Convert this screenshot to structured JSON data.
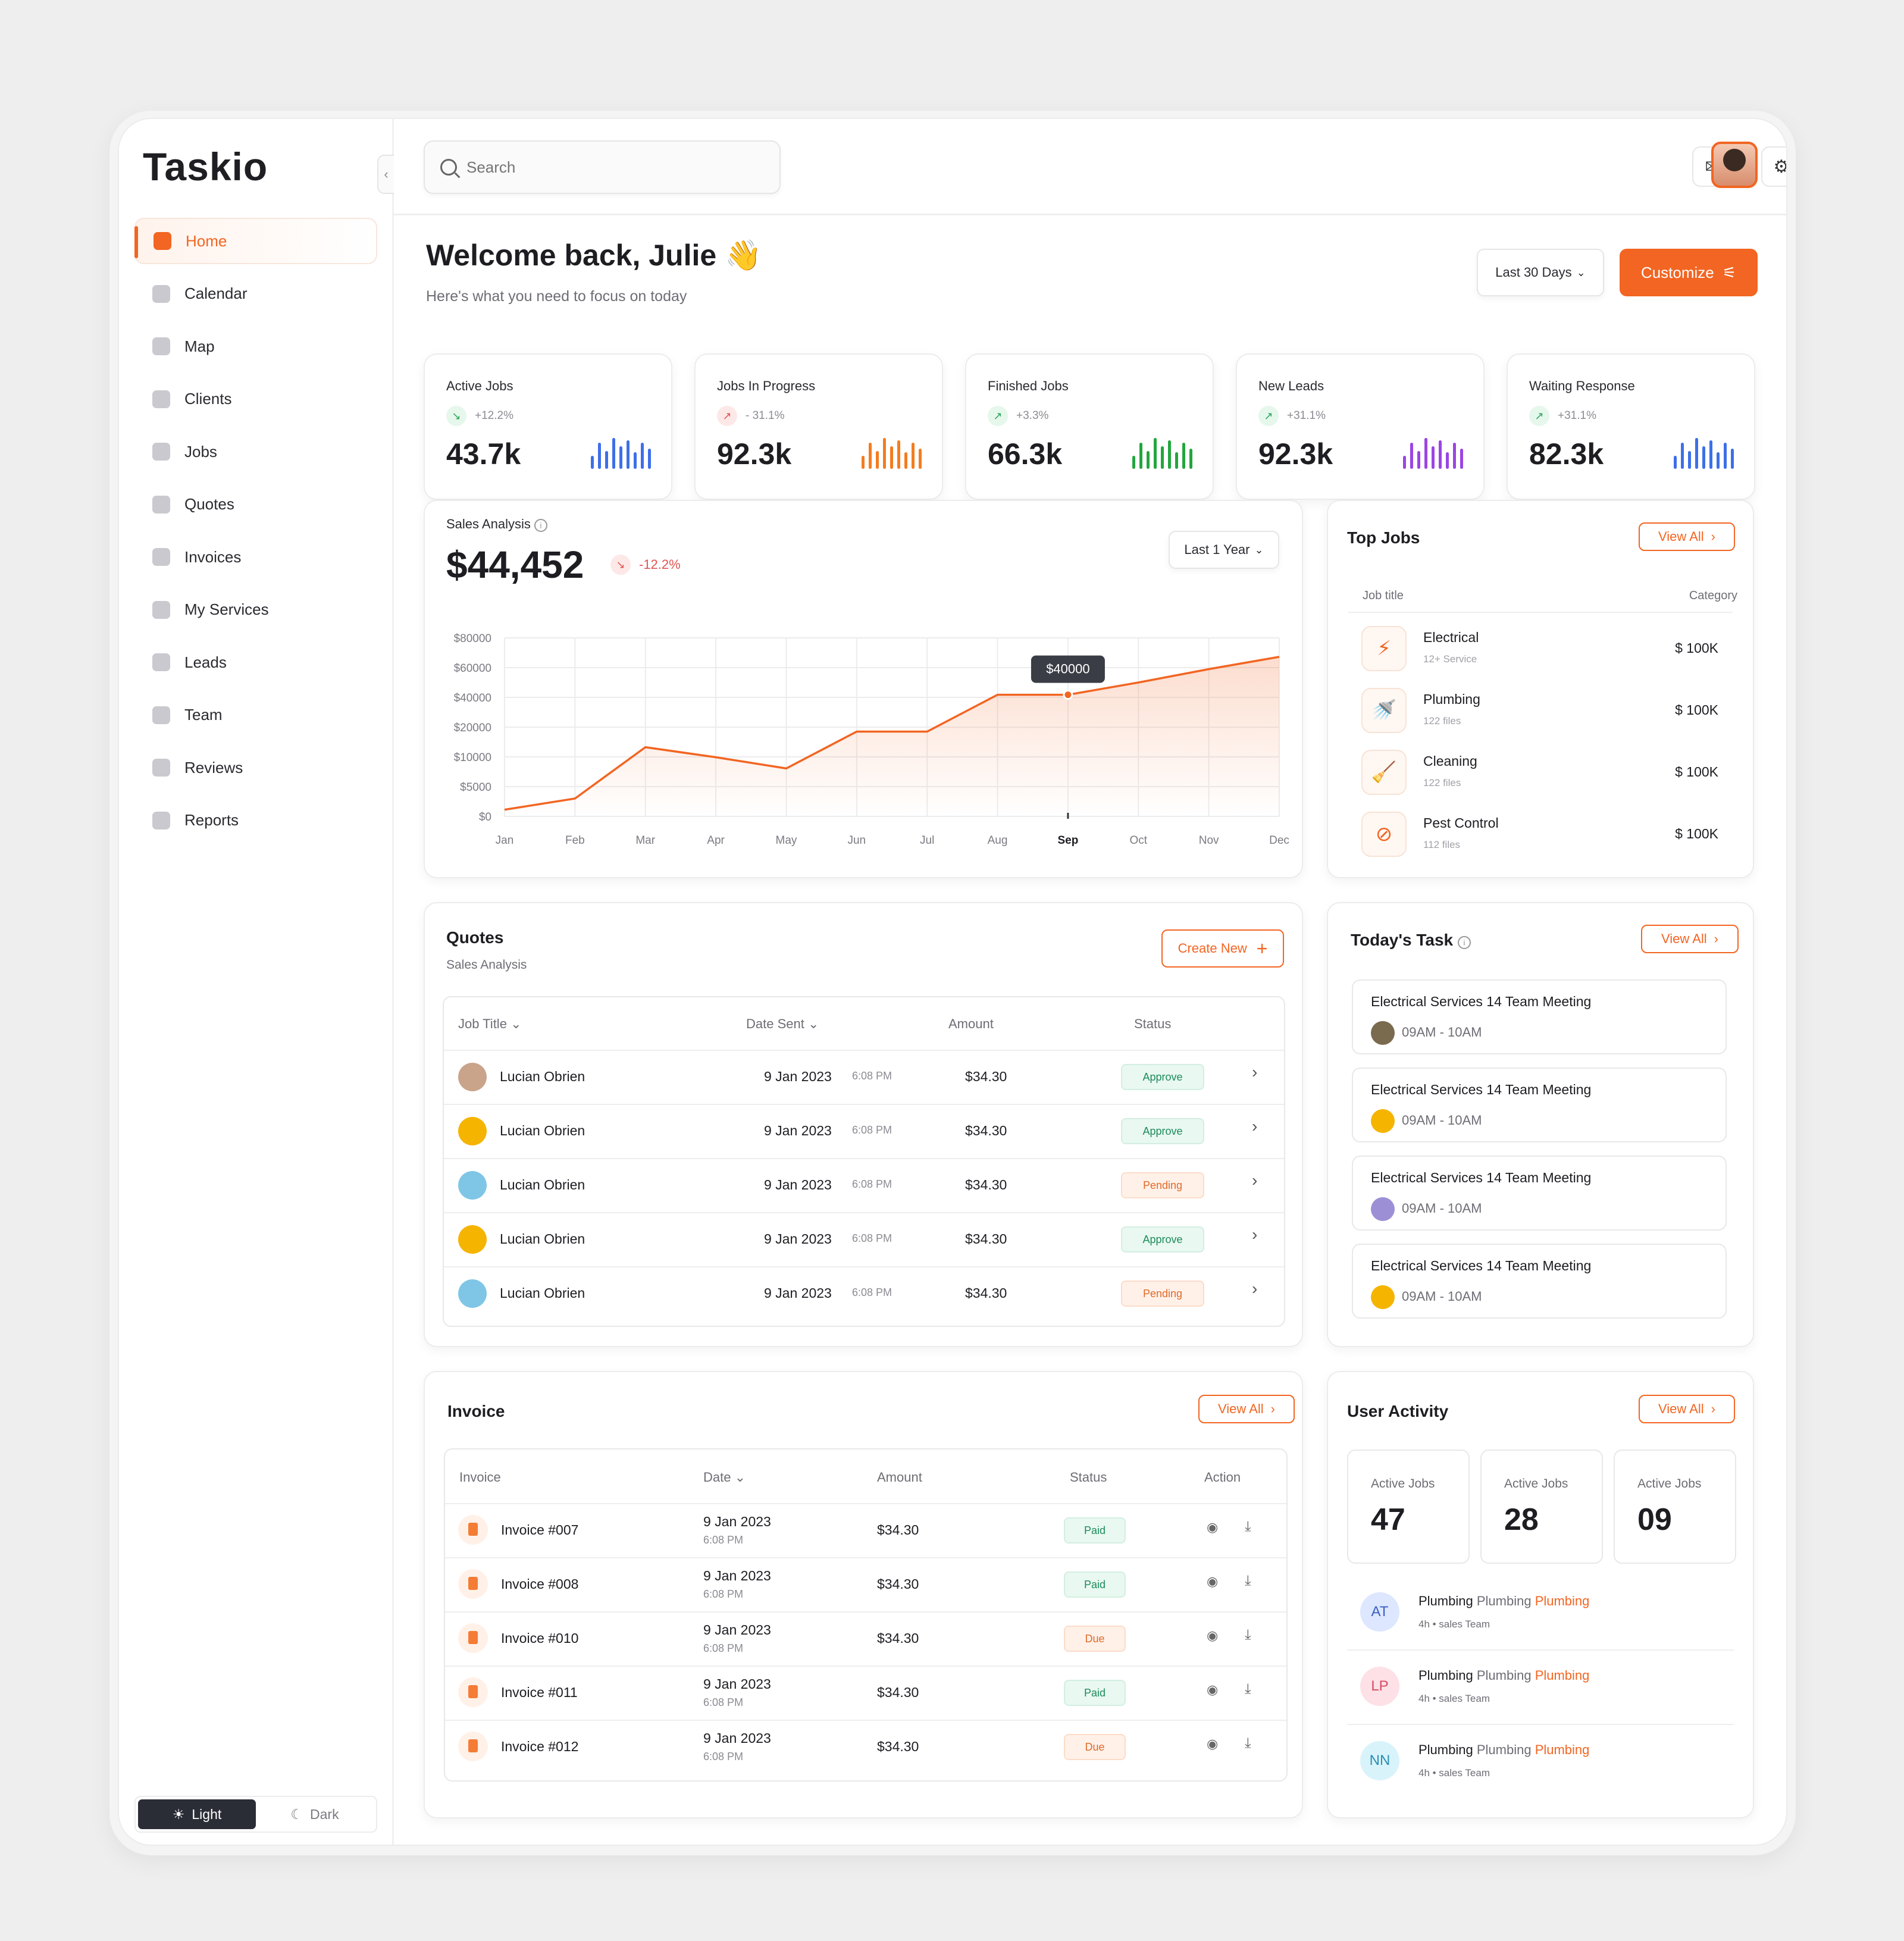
{
  "app": {
    "logo": "Taskio",
    "collapse_icon": "chevron-left-icon"
  },
  "sidebar": {
    "items": [
      {
        "label": "Home",
        "icon": "home-icon",
        "active": true
      },
      {
        "label": "Calendar",
        "icon": "calendar-icon"
      },
      {
        "label": "Map",
        "icon": "map-pin-icon"
      },
      {
        "label": "Clients",
        "icon": "user-icon"
      },
      {
        "label": "Jobs",
        "icon": "briefcase-icon"
      },
      {
        "label": "Quotes",
        "icon": "shield-icon"
      },
      {
        "label": "Invoices",
        "icon": "document-icon"
      },
      {
        "label": "My Services",
        "icon": "clipboard-icon"
      },
      {
        "label": "Leads",
        "icon": "user-circle-icon"
      },
      {
        "label": "Team",
        "icon": "team-icon"
      },
      {
        "label": "Reviews",
        "icon": "chat-icon"
      },
      {
        "label": "Reports",
        "icon": "report-icon"
      }
    ],
    "theme": {
      "light": "Light",
      "dark": "Dark",
      "selected": "Light"
    }
  },
  "topbar": {
    "search_placeholder": "Search",
    "mail_icon": "mail-icon",
    "settings_icon": "gear-icon",
    "notification_badge": true
  },
  "header": {
    "title": "Welcome back, Julie",
    "emoji": "👋",
    "subtitle": "Here's what you need to focus on today",
    "range": "Last 30 Days",
    "customize": "Customize"
  },
  "stats": [
    {
      "label": "Active Jobs",
      "change": "+12.2%",
      "trend": "down",
      "value": "43.7k",
      "color": "#3d6fe8"
    },
    {
      "label": "Jobs In Progress",
      "change": "- 31.1%",
      "trend": "up-red",
      "value": "92.3k",
      "color": "#f47c20"
    },
    {
      "label": "Finished Jobs",
      "change": "+3.3%",
      "trend": "up",
      "value": "66.3k",
      "color": "#22a63e"
    },
    {
      "label": "New Leads",
      "change": "+31.1%",
      "trend": "up",
      "value": "92.3k",
      "color": "#9b45e4"
    },
    {
      "label": "Waiting Response",
      "change": "+31.1%",
      "trend": "up",
      "value": "82.3k",
      "color": "#3d6fe8"
    }
  ],
  "sales": {
    "title": "Sales Analysis",
    "total": "$44,452",
    "change": "-12.2%",
    "range": "Last 1 Year"
  },
  "chart_data": {
    "type": "area",
    "categories": [
      "Jan",
      "Feb",
      "Mar",
      "Apr",
      "May",
      "Jun",
      "Jul",
      "Aug",
      "Sep",
      "Oct",
      "Nov",
      "Dec"
    ],
    "y_ticks": [
      "$80000",
      "$60000",
      "$40000",
      "$20000",
      "$10000",
      "$5000",
      "$0"
    ],
    "series": [
      {
        "values": [
          0.6,
          1.6,
          6.2,
          5.3,
          4.3,
          7.6,
          7.6,
          10.9,
          10.9,
          12.0,
          13.2,
          14.3
        ]
      }
    ],
    "y_tick_values": [
      80000,
      60000,
      40000,
      20000,
      10000,
      5000,
      0
    ],
    "highlight": {
      "category": "Sep",
      "label": "$40000"
    },
    "color": "#f26522",
    "grid": true
  },
  "top_jobs": {
    "title": "Top Jobs",
    "view_all": "View All",
    "col_title": "Job title",
    "col_category": "Category",
    "rows": [
      {
        "name": "Electrical",
        "sub": "12+ Service",
        "amount": "$ 100K",
        "icon": "plug-icon"
      },
      {
        "name": "Plumbing",
        "sub": "122 files",
        "amount": "$ 100K",
        "icon": "faucet-icon"
      },
      {
        "name": "Cleaning",
        "sub": "122 files",
        "amount": "$ 100K",
        "icon": "broom-icon"
      },
      {
        "name": "Pest Control",
        "sub": "112 files",
        "amount": "$ 100K",
        "icon": "no-bug-icon"
      }
    ]
  },
  "quotes": {
    "title": "Quotes",
    "subtitle": "Sales Analysis",
    "create": "Create New",
    "cols": [
      "Job Title",
      "Date Sent",
      "Amount",
      "Status"
    ],
    "rows": [
      {
        "name": "Lucian Obrien",
        "date": "9 Jan 2023",
        "time": "6:08 PM",
        "amount": "$34.30",
        "status": "Approve",
        "avatar": "#c9a48a"
      },
      {
        "name": "Lucian Obrien",
        "date": "9 Jan 2023",
        "time": "6:08 PM",
        "amount": "$34.30",
        "status": "Approve",
        "avatar": "#f5b400"
      },
      {
        "name": "Lucian Obrien",
        "date": "9 Jan 2023",
        "time": "6:08 PM",
        "amount": "$34.30",
        "status": "Pending",
        "avatar": "#7fc6e6"
      },
      {
        "name": "Lucian Obrien",
        "date": "9 Jan 2023",
        "time": "6:08 PM",
        "amount": "$34.30",
        "status": "Approve",
        "avatar": "#f5b400"
      },
      {
        "name": "Lucian Obrien",
        "date": "9 Jan 2023",
        "time": "6:08 PM",
        "amount": "$34.30",
        "status": "Pending",
        "avatar": "#7fc6e6"
      }
    ]
  },
  "tasks": {
    "title": "Today's Task",
    "view_all": "View All",
    "rows": [
      {
        "title": "Electrical Services 14 Team Meeting",
        "time": "09AM - 10AM",
        "avatar": "#7a6a4e"
      },
      {
        "title": "Electrical Services 14 Team Meeting",
        "time": "09AM - 10AM",
        "avatar": "#f5b400"
      },
      {
        "title": "Electrical Services 14 Team Meeting",
        "time": "09AM - 10AM",
        "avatar": "#9d8fd6"
      },
      {
        "title": "Electrical Services 14 Team Meeting",
        "time": "09AM - 10AM",
        "avatar": "#f5b400"
      }
    ]
  },
  "invoice": {
    "title": "Invoice",
    "view_all": "View All",
    "cols": [
      "Invoice",
      "Date",
      "Amount",
      "Status",
      "Action"
    ],
    "rows": [
      {
        "name": "Invoice #007",
        "date": "9 Jan 2023",
        "time": "6:08 PM",
        "amount": "$34.30",
        "status": "Paid"
      },
      {
        "name": "Invoice #008",
        "date": "9 Jan 2023",
        "time": "6:08 PM",
        "amount": "$34.30",
        "status": "Paid"
      },
      {
        "name": "Invoice #010",
        "date": "9 Jan 2023",
        "time": "6:08 PM",
        "amount": "$34.30",
        "status": "Due"
      },
      {
        "name": "Invoice #011",
        "date": "9 Jan 2023",
        "time": "6:08 PM",
        "amount": "$34.30",
        "status": "Paid"
      },
      {
        "name": "Invoice #012",
        "date": "9 Jan 2023",
        "time": "6:08 PM",
        "amount": "$34.30",
        "status": "Due"
      }
    ]
  },
  "activity": {
    "title": "User Activity",
    "view_all": "View All",
    "boxes": [
      {
        "label": "Active Jobs",
        "value": "47"
      },
      {
        "label": "Active Jobs",
        "value": "28"
      },
      {
        "label": "Active Jobs",
        "value": "09"
      }
    ],
    "rows": [
      {
        "initials": "AT",
        "a": "Plumbing",
        "b": "Plumbing",
        "c": "Plumbing",
        "meta": "4h • sales Team",
        "bg": "#dde7ff",
        "fg": "#3d5fc4"
      },
      {
        "initials": "LP",
        "a": "Plumbing",
        "b": "Plumbing",
        "c": "Plumbing",
        "meta": "4h • sales Team",
        "bg": "#fde1e6",
        "fg": "#d84a63"
      },
      {
        "initials": "NN",
        "a": "Plumbing",
        "b": "Plumbing",
        "c": "Plumbing",
        "meta": "4h • sales Team",
        "bg": "#d9f3fb",
        "fg": "#2b8fb3"
      }
    ]
  }
}
